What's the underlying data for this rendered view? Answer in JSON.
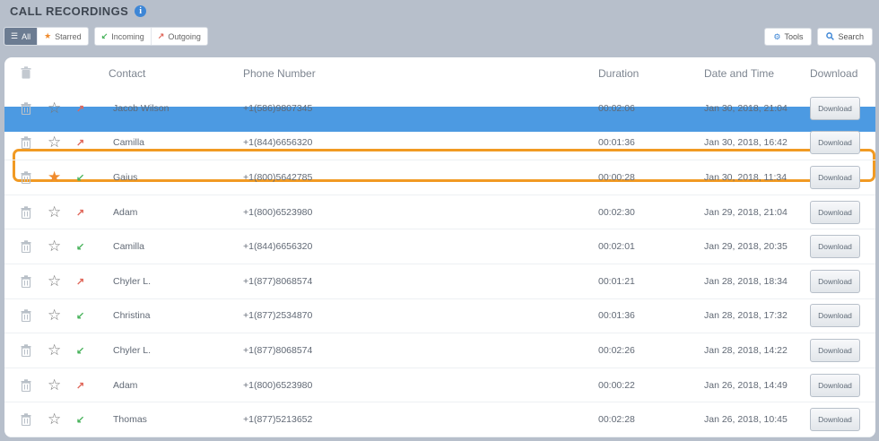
{
  "header": {
    "title": "CALL RECORDINGS",
    "info_glyph": "i"
  },
  "filters": {
    "all": "All",
    "starred": "Starred",
    "incoming": "Incoming",
    "outgoing": "Outgoing",
    "active": "All"
  },
  "toolbar": {
    "tools": "Tools",
    "search": "Search"
  },
  "table": {
    "columns": {
      "contact": "Contact",
      "phone": "Phone Number",
      "duration": "Duration",
      "datetime": "Date and Time",
      "download": "Download"
    },
    "rows": [
      {
        "contact": "Jacob Wilson",
        "phone": "+1(586)9807345",
        "duration": "00:02:06",
        "datetime": "Jan 30, 2018, 21:04",
        "direction": "outgoing",
        "starred": false,
        "download": "Download",
        "highlighted": true
      },
      {
        "contact": "Camilla",
        "phone": "+1(844)6656320",
        "duration": "00:01:36",
        "datetime": "Jan 30, 2018, 16:42",
        "direction": "outgoing",
        "starred": false,
        "download": "Download"
      },
      {
        "contact": "Gaius",
        "phone": "+1(800)5642785",
        "duration": "00:00:28",
        "datetime": "Jan 30, 2018, 11:34",
        "direction": "incoming",
        "starred": true,
        "download": "Download"
      },
      {
        "contact": "Adam",
        "phone": "+1(800)6523980",
        "duration": "00:02:30",
        "datetime": "Jan 29, 2018, 21:04",
        "direction": "outgoing",
        "starred": false,
        "download": "Download"
      },
      {
        "contact": "Camilla",
        "phone": "+1(844)6656320",
        "duration": "00:02:01",
        "datetime": "Jan 29, 2018, 20:35",
        "direction": "incoming",
        "starred": false,
        "download": "Download"
      },
      {
        "contact": "Chyler L.",
        "phone": "+1(877)8068574",
        "duration": "00:01:21",
        "datetime": "Jan 28, 2018, 18:34",
        "direction": "outgoing",
        "starred": false,
        "download": "Download"
      },
      {
        "contact": "Christina",
        "phone": "+1(877)2534870",
        "duration": "00:01:36",
        "datetime": "Jan 28, 2018, 17:32",
        "direction": "incoming",
        "starred": false,
        "download": "Download"
      },
      {
        "contact": "Chyler L.",
        "phone": "+1(877)8068574",
        "duration": "00:02:26",
        "datetime": "Jan 28, 2018, 14:22",
        "direction": "incoming",
        "starred": false,
        "download": "Download"
      },
      {
        "contact": "Adam",
        "phone": "+1(800)6523980",
        "duration": "00:00:22",
        "datetime": "Jan 26, 2018, 14:49",
        "direction": "outgoing",
        "starred": false,
        "download": "Download"
      },
      {
        "contact": "Thomas",
        "phone": "+1(877)5213652",
        "duration": "00:02:28",
        "datetime": "Jan 26, 2018, 10:45",
        "direction": "incoming",
        "starred": false,
        "download": "Download"
      }
    ]
  },
  "icons": {
    "row": [
      "trash-icon",
      "star-icon",
      "direction-arrow-icon"
    ],
    "filters": [
      "list-icon",
      "star-icon",
      "incoming-arrow-icon",
      "outgoing-arrow-icon"
    ],
    "toolbar": [
      "gear-icon",
      "search-icon"
    ]
  },
  "colors": {
    "background": "#b7bfcb",
    "accent_blue": "#3d86d6",
    "selection_strip": "#4c9ae2",
    "highlight_border": "#f19a23",
    "starred": "#f08b2d",
    "incoming": "#49b35c",
    "outgoing": "#e0675a"
  }
}
